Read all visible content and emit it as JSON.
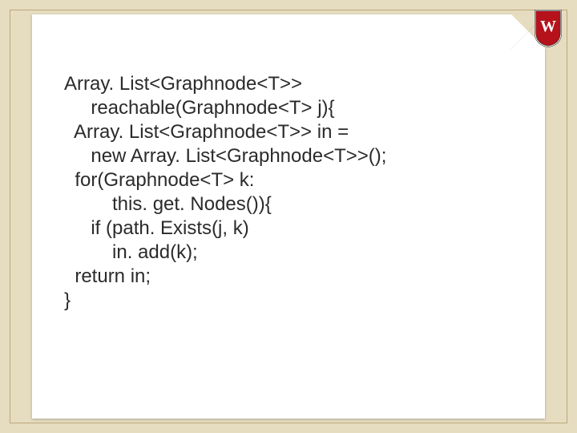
{
  "code": {
    "l1": "Array. List<Graphnode<T>>",
    "l2": "     reachable(Graphnode<T> j){",
    "l3": "  Array. List<Graphnode<T>> in =",
    "l4": "     new Array. List<Graphnode<T>>();",
    "l5": "  for(Graphnode<T> k:",
    "l6": "         this. get. Nodes()){",
    "l7": "     if (path. Exists(j, k)",
    "l8": "         in. add(k);",
    "l9": "  return in;",
    "l10": "}"
  },
  "crest": {
    "letter": "W",
    "shield_fill": "#b5121b",
    "shield_stroke": "#1a1a1a"
  }
}
